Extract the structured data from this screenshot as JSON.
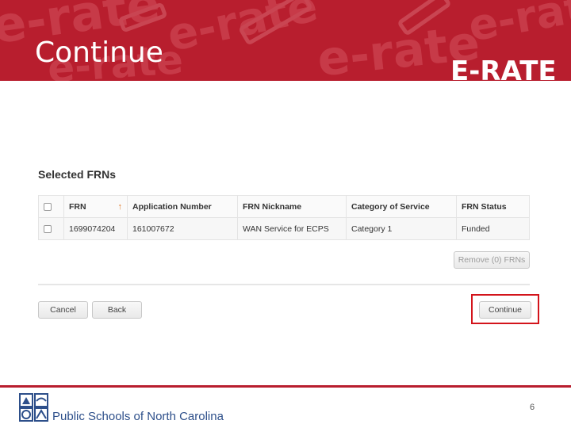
{
  "slide": {
    "title": "Continue",
    "brand": "E-RATE",
    "watermark": "e-rate",
    "page_number": "6"
  },
  "section": {
    "heading": "Selected FRNs"
  },
  "table": {
    "columns": [
      "FRN",
      "Application Number",
      "FRN Nickname",
      "Category of Service",
      "FRN Status"
    ],
    "sort_indicator": "↑",
    "rows": [
      {
        "frn": "1699074204",
        "application_number": "161007672",
        "nickname": "WAN Service for ECPS",
        "category": "Category 1",
        "status": "Funded"
      }
    ]
  },
  "buttons": {
    "remove": "Remove (0) FRNs",
    "cancel": "Cancel",
    "back": "Back",
    "continue": "Continue"
  },
  "footer": {
    "organization": "Public Schools of North Carolina"
  },
  "colors": {
    "banner_red": "#b81e2e",
    "highlight_red": "#d3141b",
    "org_blue": "#2d4f8a",
    "sort_orange": "#e07b2a"
  },
  "icons": {
    "logo": "nc-dpi-logo-icon",
    "checkbox": "checkbox-icon",
    "sort": "sort-ascending-icon"
  }
}
